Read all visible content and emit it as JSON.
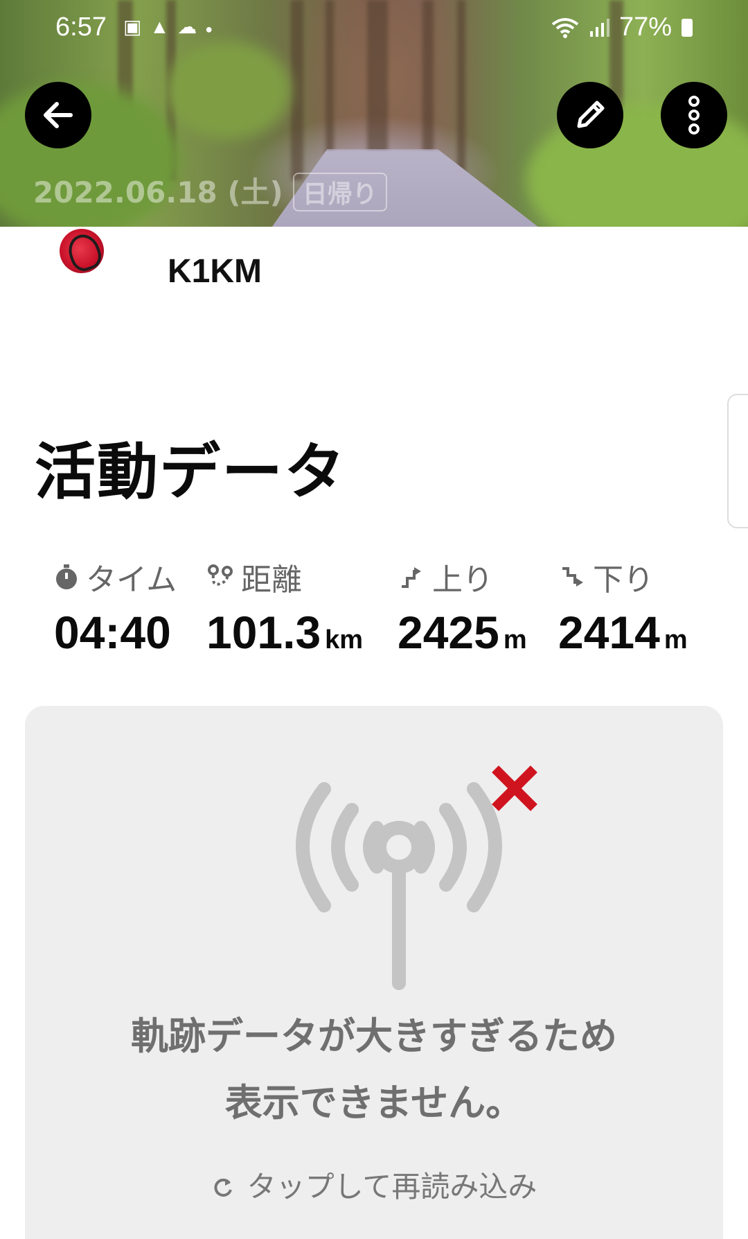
{
  "status_bar": {
    "time": "6:57",
    "battery": "77%"
  },
  "header": {
    "date": "2022.06.18 (土)",
    "badge": "日帰り"
  },
  "profile": {
    "username": "K1KM"
  },
  "section": {
    "title": "活動データ"
  },
  "stats": [
    {
      "icon": "stopwatch-icon",
      "label": "タイム",
      "value": "04:40",
      "unit": ""
    },
    {
      "icon": "route-icon",
      "label": "距離",
      "value": "101.3",
      "unit": "km"
    },
    {
      "icon": "ascent-icon",
      "label": "上り",
      "value": "2425",
      "unit": "m"
    },
    {
      "icon": "descent-icon",
      "label": "下り",
      "value": "2414",
      "unit": "m"
    }
  ],
  "map_error": {
    "line1": "軌跡データが大きすぎるため",
    "line2": "表示できません。",
    "reload_label": "タップして再読み込み"
  },
  "colors": {
    "error_x": "#d0141f",
    "icon_gray": "#c4c4c4",
    "card_bg": "#eeeeee"
  }
}
